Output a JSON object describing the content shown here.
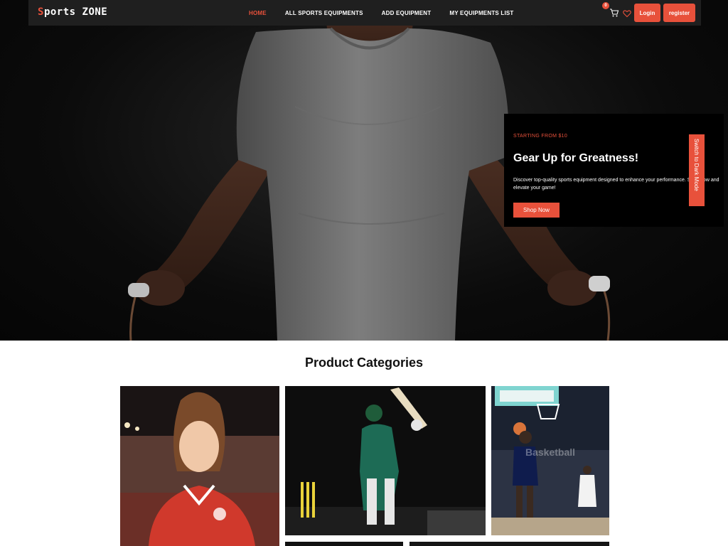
{
  "brand": {
    "first": "S",
    "rest": "ports ZONE"
  },
  "nav": {
    "links": [
      "HOME",
      "ALL SPORTS EQUIPMENTS",
      "ADD EQUIPMENT",
      "MY EQUIPMENTS LIST"
    ],
    "active_index": 0
  },
  "actions": {
    "cart_count": "0",
    "login": "Login",
    "register": "register"
  },
  "promo": {
    "kicker": "STARTING FROM $10",
    "title": "Gear Up for Greatness!",
    "description": "Discover top-quality sports equipment designed to enhance your performance. Shop now and elevate your game!",
    "cta": "Shop Now"
  },
  "theme_toggle": "Switch to Dark Mode",
  "categories": {
    "title": "Product Categories",
    "items": [
      {
        "label": ""
      },
      {
        "label": ""
      },
      {
        "label": "Basketball"
      }
    ]
  },
  "colors": {
    "accent": "#e8513b",
    "navbar": "#1f1f1f",
    "hero_bg": "#0b0b0b"
  }
}
